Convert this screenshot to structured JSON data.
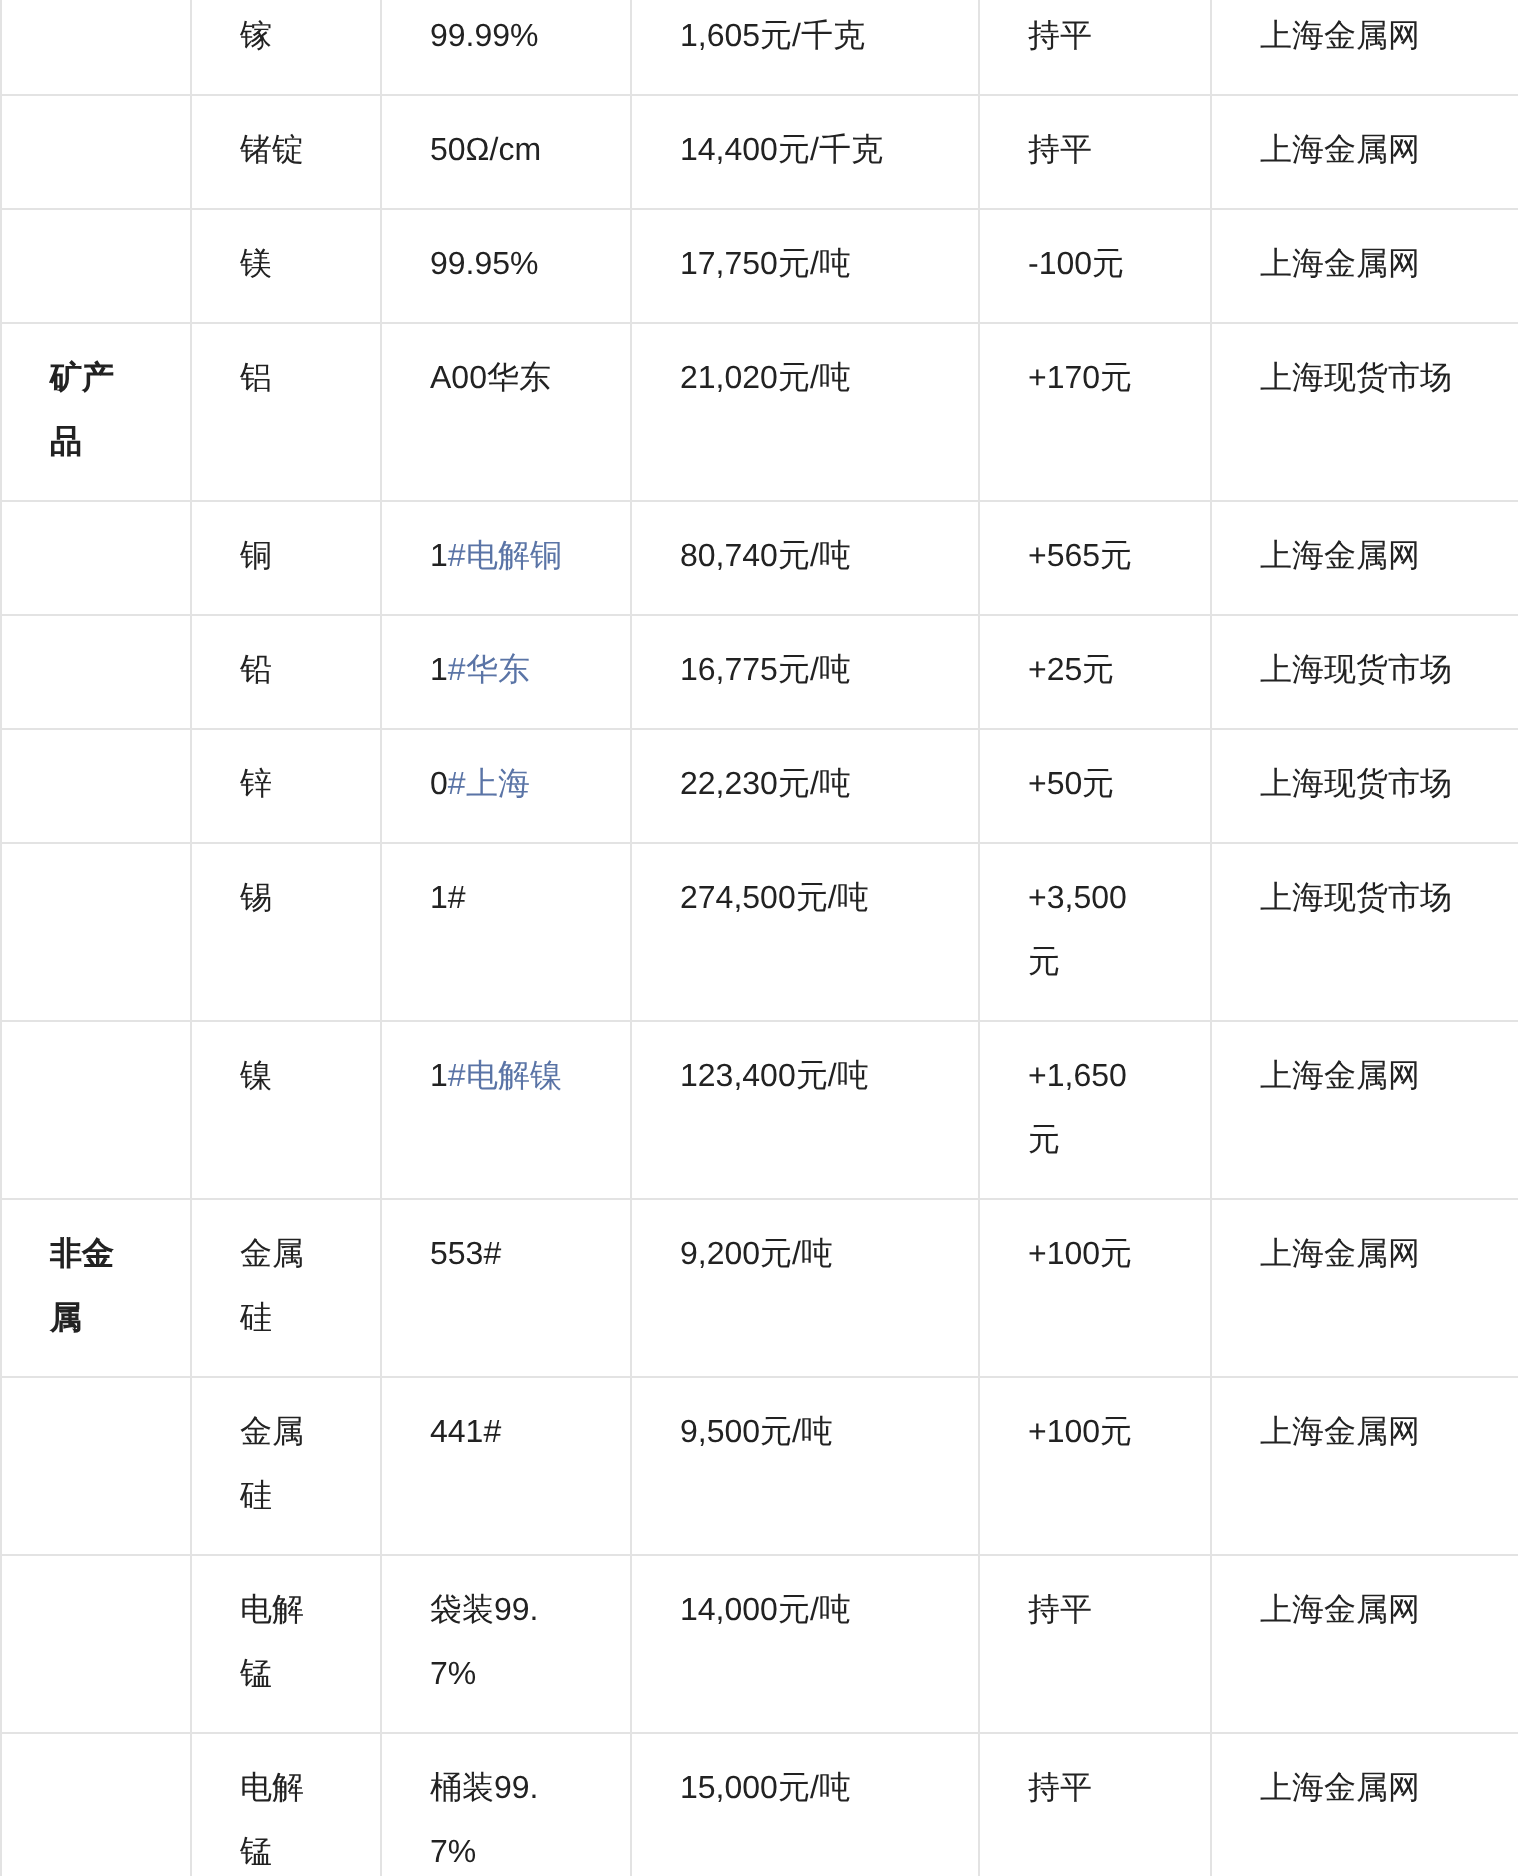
{
  "table": {
    "rows": [
      {
        "name": "镓",
        "spec": {
          "text": "99.99%"
        },
        "price": "1,605元/千克",
        "change": "持平",
        "source": "上海金属网"
      },
      {
        "name": "锗锭",
        "spec": {
          "text": "50Ω/cm"
        },
        "price": "14,400元/千克",
        "change": "持平",
        "source": "上海金属网"
      },
      {
        "name": "镁",
        "spec": {
          "text": "99.95%"
        },
        "price": "17,750元/吨",
        "change": "-100元",
        "source": "上海金属网"
      },
      {
        "category": "矿产品",
        "name": "铝",
        "spec": {
          "text": "A00华东"
        },
        "price": "21,020元/吨",
        "change": "+170元",
        "source": "上海现货市场"
      },
      {
        "name": "铜",
        "spec": {
          "text": "1",
          "link": "#电解铜"
        },
        "price": "80,740元/吨",
        "change": "+565元",
        "source": "上海金属网"
      },
      {
        "name": "铅",
        "spec": {
          "text": "1",
          "link": "#华东"
        },
        "price": "16,775元/吨",
        "change": "+25元",
        "source": "上海现货市场"
      },
      {
        "name": "锌",
        "spec": {
          "text": "0",
          "link": "#上海"
        },
        "price": "22,230元/吨",
        "change": "+50元",
        "source": "上海现货市场"
      },
      {
        "name": "锡",
        "spec": {
          "text": "1#"
        },
        "price": "274,500元/吨",
        "change": "+3,500元",
        "source": "上海现货市场"
      },
      {
        "name": "镍",
        "spec": {
          "text": "1",
          "link": "#电解镍"
        },
        "price": "123,400元/吨",
        "change": "+1,650元",
        "source": "上海金属网"
      },
      {
        "category": "非金属",
        "name": "金属硅",
        "spec": {
          "text": "553#"
        },
        "price": "9,200元/吨",
        "change": "+100元",
        "source": "上海金属网"
      },
      {
        "name": "金属硅",
        "spec": {
          "text": "441#"
        },
        "price": "9,500元/吨",
        "change": "+100元",
        "source": "上海金属网"
      },
      {
        "name": "电解锰",
        "spec": {
          "text": "袋装99.7%"
        },
        "price": "14,000元/吨",
        "change": "持平",
        "source": "上海金属网"
      },
      {
        "name": "电解锰",
        "spec": {
          "text": "桶装99.7%"
        },
        "price": "15,000元/吨",
        "change": "持平",
        "source": "上海金属网"
      }
    ]
  }
}
